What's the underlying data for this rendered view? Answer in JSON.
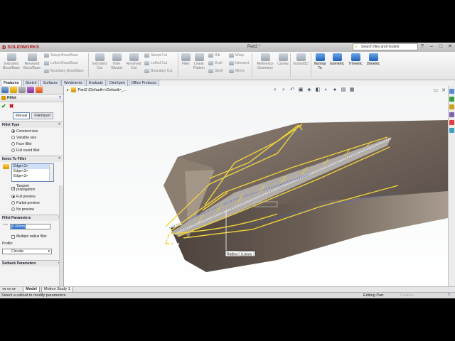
{
  "app": {
    "name": "SOLIDWORKS",
    "doc_title": "Part2 *"
  },
  "search": {
    "placeholder": "Search files and models"
  },
  "window_controls": [
    "?",
    "–",
    "□",
    "✕"
  ],
  "toolbar": {
    "large_left": [
      {
        "label": "Extruded Boss/Base"
      },
      {
        "label": "Revolved Boss/Base"
      }
    ],
    "boss_small": [
      "Swept Boss/Base",
      "Lofted Boss/Base",
      "Boundary Boss/Base"
    ],
    "cut_large": [
      {
        "label": "Extruded Cut"
      },
      {
        "label": "Hole Wizard"
      },
      {
        "label": "Revolved Cut"
      }
    ],
    "cut_small": [
      "Swept Cut",
      "Lofted Cut",
      "Boundary Cut"
    ],
    "features": [
      {
        "label": "Fillet"
      },
      {
        "label": "Linear Pattern"
      }
    ],
    "feat_small_1": [
      "Rib",
      "Draft",
      "Shell"
    ],
    "feat_small_2": [
      "Wrap",
      "Intersect",
      "Mirror"
    ],
    "ref": [
      {
        "label": "Reference Geometry"
      },
      {
        "label": "Curves"
      },
      {
        "label": "Instant3D"
      }
    ],
    "views": [
      {
        "label": "Normal To"
      },
      {
        "label": "Isometric"
      },
      {
        "label": "Trimetric"
      },
      {
        "label": "Dimetric"
      }
    ]
  },
  "tabs": [
    "Features",
    "Sketch",
    "Surfaces",
    "Weldments",
    "Evaluate",
    "DimXpert",
    "Office Products"
  ],
  "tree": {
    "item": "Part2  (Default<<Default>_..."
  },
  "property_manager": {
    "title": "Fillet",
    "mode_tabs": [
      "Manual",
      "FilletXpert"
    ],
    "fillet_type": {
      "heading": "Fillet Type",
      "options": [
        "Constant size",
        "Variable size",
        "Face fillet",
        "Full round fillet"
      ],
      "selected": "Constant size"
    },
    "items_to_fillet": {
      "heading": "Items To Fillet",
      "edges": [
        "Edge<1>",
        "Edge<2>",
        "Edge<3>"
      ],
      "tangent_propagation_label": "Tangent propagation",
      "tangent_propagation": true,
      "preview_options": [
        "Full preview",
        "Partial preview",
        "No preview"
      ],
      "preview_selected": "Full preview"
    },
    "fillet_parameters": {
      "heading": "Fillet Parameters",
      "radius": "0.40mm",
      "multiple_radius_label": "Multiple radius fillet",
      "multiple_radius": false,
      "profile_label": "Profile:",
      "profile_value": "Circular"
    },
    "setback": {
      "heading": "Setback Parameters"
    }
  },
  "viewport": {
    "callout_label": "Radius:",
    "callout_value": "0.4mm"
  },
  "bottom_tabs": [
    "Model",
    "Motion Study 1"
  ],
  "status": {
    "left": "Select a callout to modify parameters",
    "mode": "Editing Part",
    "units": "Custom",
    "help": "?"
  },
  "colors": {
    "preview": "#f0d23c",
    "accent": "#2060c0",
    "model": "#7a6a5c"
  }
}
